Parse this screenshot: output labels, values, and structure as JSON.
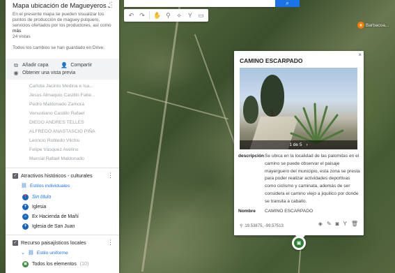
{
  "panel": {
    "title": "Mapa ubicación de Magueyeros Ji...",
    "description": "En el presente mapa se pueden visualizar los puntos de producción de maguey pulquero, servicios ofertados por los productores, así como",
    "more": "más",
    "views": "24 vistas",
    "saved": "Todos los cambios se han guardado en Drive.",
    "actions": {
      "add_layer": "Añadir capa",
      "share": "Compartir",
      "preview": "Obtener una vista previa"
    },
    "names": [
      "Carlota Jacinto Medina e Isa...",
      "Jesus Almaquio Castillo Fabe...",
      "Pedro Maldonado Zamora",
      "Venustiano Castillo Rafael",
      "DIEGO ANDRES TELLES",
      "ALFREDO ANASTASCIO PIÑA",
      "Leoncio Robledo Vilchis",
      "Felipe Vásquez Avelino",
      "Marcial Rafael Maldonado"
    ],
    "layers": [
      {
        "title": "Atractivos históricos - culturales",
        "style": "Estilos individuales",
        "items": [
          "Sin título",
          "Iglesia",
          "Ex Hacienda de Mañí",
          "Iglesia de San Juan"
        ]
      },
      {
        "title": "Recurso paisajísticos locales",
        "style": "Estilo uniforme",
        "items": [
          "Todos los elementos"
        ],
        "count": "(10)"
      }
    ]
  },
  "popup": {
    "title": "CAMINO ESCARPADO",
    "photo_counter": "1 de 5",
    "description_label": "descripción",
    "description": "Se ubica en la localidad de las palomitas en el camino se puede observar el paisaje mayerguero del municipio, esta zona se presta para poder realizar actividades deportivas como ciclismo y caminata, además de ser considera el camino viejo a jiquilico por donde se transita a caballo.",
    "name_label": "Nombre",
    "name": "CAMINO ESCARPADO",
    "coords": "19.53875, -99.57513"
  },
  "map": {
    "poi_label": "Barbacoa..."
  },
  "icons": {
    "undo": "undo-icon",
    "redo": "redo-icon",
    "hand": "hand-icon",
    "marker": "marker-icon",
    "line": "line-icon",
    "route": "route-icon",
    "ruler": "ruler-icon"
  }
}
